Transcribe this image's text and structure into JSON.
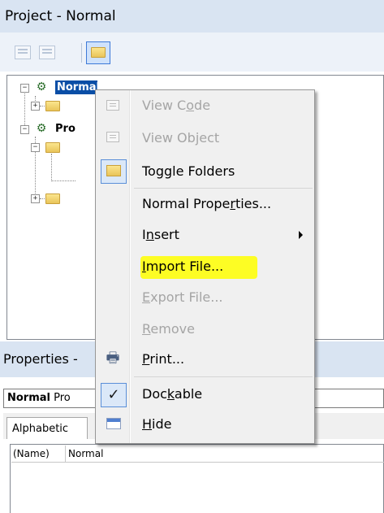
{
  "project_window": {
    "title": "Project - Normal",
    "toolbar": {
      "view_code_icon": "view-code-icon",
      "view_object_icon": "view-object-icon",
      "toggle_folders_icon": "folder-icon"
    },
    "tree": {
      "nodes": [
        {
          "label": "Normal",
          "selected": true
        },
        {
          "label": "Pro",
          "selected": false
        }
      ]
    }
  },
  "properties_window": {
    "title": "Properties -",
    "object_combo": {
      "bold": "Normal",
      "rest": "Pro"
    },
    "tab_label": "Alphabetic",
    "row": {
      "name": "(Name)",
      "value": "Normal"
    }
  },
  "context_menu": {
    "items": [
      {
        "label_pre": "View C",
        "label_ul": "o",
        "label_post": "de",
        "enabled": false,
        "icon": "view-code-icon"
      },
      {
        "label_pre": "View Ob",
        "label_ul": "j",
        "label_post": "ect",
        "enabled": false,
        "icon": "view-object-icon"
      },
      {
        "label_pre": "Toggle Folders",
        "label_ul": "",
        "label_post": "",
        "enabled": true,
        "icon": "folder-icon"
      },
      {
        "label_pre": "Normal Prope",
        "label_ul": "r",
        "label_post": "ties...",
        "enabled": true,
        "icon": ""
      },
      {
        "label_pre": "I",
        "label_ul": "n",
        "label_post": "sert",
        "enabled": true,
        "icon": "",
        "submenu": true
      },
      {
        "label_pre": "",
        "label_ul": "I",
        "label_post": "mport File...",
        "enabled": true,
        "icon": "",
        "highlighted": true
      },
      {
        "label_pre": "",
        "label_ul": "E",
        "label_post": "xport File...",
        "enabled": false,
        "icon": ""
      },
      {
        "label_pre": "",
        "label_ul": "R",
        "label_post": "emove",
        "enabled": false,
        "icon": ""
      },
      {
        "label_pre": "",
        "label_ul": "P",
        "label_post": "rint...",
        "enabled": true,
        "icon": "printer-icon"
      },
      {
        "label_pre": "Doc",
        "label_ul": "k",
        "label_post": "able",
        "enabled": true,
        "icon": "checkmark-icon",
        "checked": true
      },
      {
        "label_pre": "",
        "label_ul": "H",
        "label_post": "ide",
        "enabled": true,
        "icon": "hide-window-icon"
      }
    ],
    "highlight_color": "#ffff00"
  }
}
